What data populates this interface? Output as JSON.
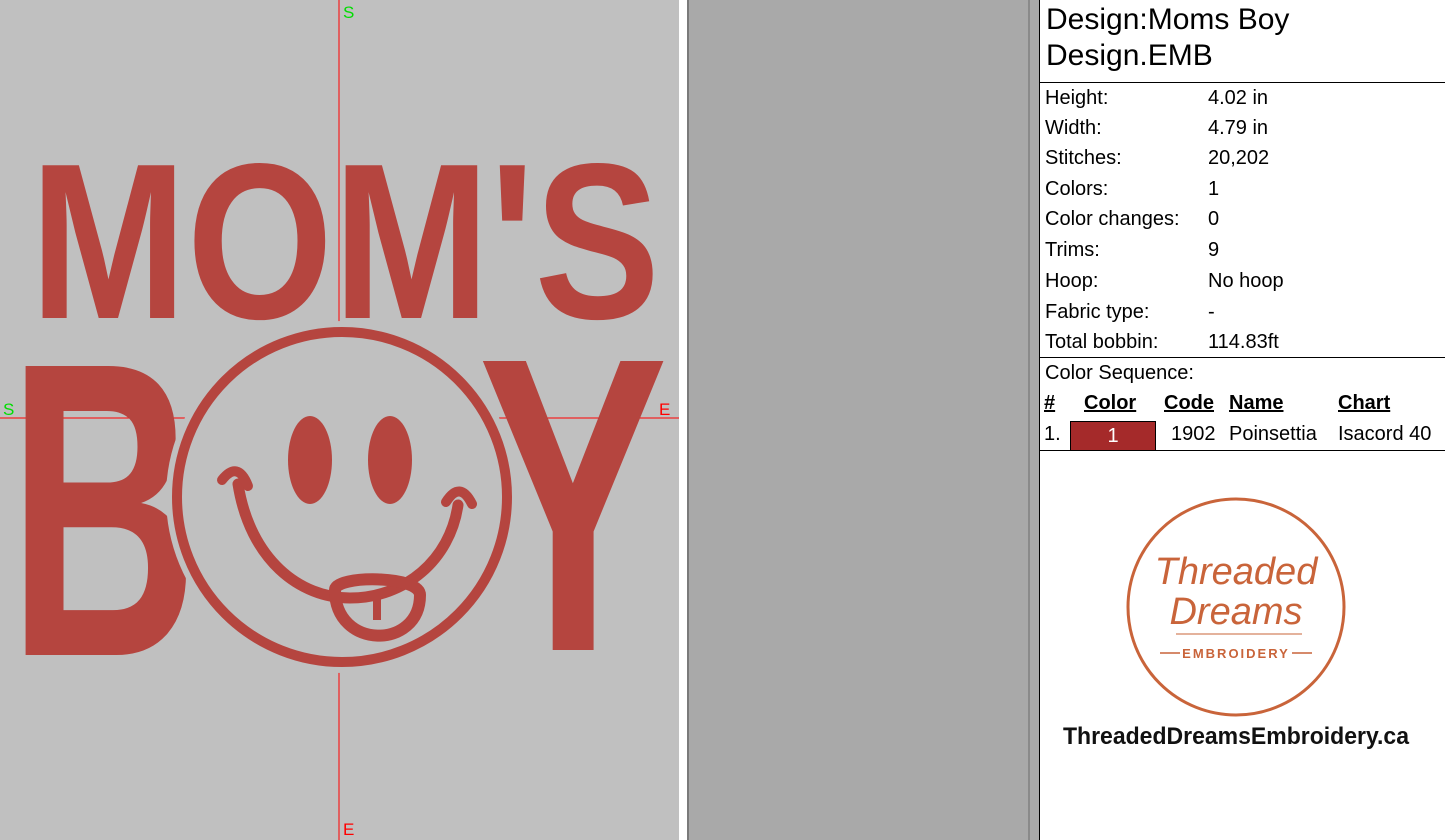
{
  "canvas": {
    "markers": {
      "top_start": "S",
      "bottom_end": "E",
      "left_start": "S",
      "right_end": "E"
    },
    "design_text": {
      "line1": "MOM'S",
      "line2_left": "B",
      "line2_right": "Y"
    }
  },
  "info": {
    "title_line1": "Design:Moms Boy",
    "title_line2": "Design.EMB",
    "stats": [
      {
        "label": "Height:",
        "value": "4.02 in"
      },
      {
        "label": "Width:",
        "value": "4.79 in"
      },
      {
        "label": "Stitches:",
        "value": "20,202"
      },
      {
        "label": "Colors:",
        "value": "1"
      },
      {
        "label": "Color changes:",
        "value": "0"
      },
      {
        "label": "Trims:",
        "value": "9"
      },
      {
        "label": "Hoop:",
        "value": "No hoop"
      },
      {
        "label": "Fabric type:",
        "value": "-"
      },
      {
        "label": "Total bobbin:",
        "value": "114.83ft"
      }
    ],
    "color_sequence_label": "Color Sequence:",
    "table_headers": {
      "num": "#",
      "color": "Color",
      "code": "Code",
      "name": "Name",
      "chart": "Chart"
    },
    "colors": [
      {
        "num": "1.",
        "swatch_label": "1",
        "swatch_color": "#a52a2a",
        "code": "1902",
        "name": "Poinsettia",
        "chart": "Isacord 40"
      }
    ]
  },
  "logo": {
    "script_line1": "Threaded",
    "script_line2": "Dreams",
    "subtitle": "EMBROIDERY",
    "url": "ThreadedDreamsEmbroidery.ca",
    "color": "#c9643a"
  },
  "embroidery_color": "#b5453f"
}
